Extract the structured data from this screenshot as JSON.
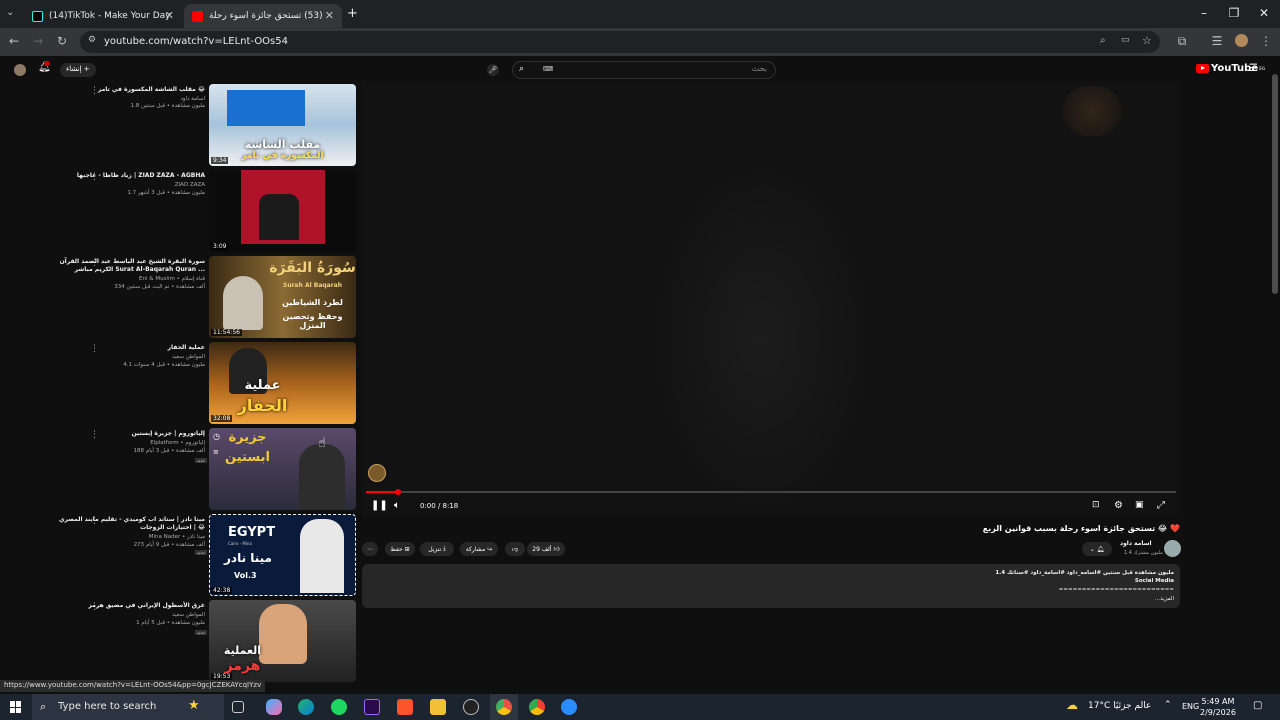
{
  "browser": {
    "tabs": [
      {
        "title": "(14)TikTok - Make Your Day",
        "active": false
      },
      {
        "title": "(53) تستحق جائزة اسوء رحلة",
        "active": true
      }
    ],
    "url": "youtube.com/watch?v=LELnt-OOs54",
    "status_url": "https://www.youtube.com/watch?v=LELnt-OOs54&pp=0gcJCZEKAYcqIYzv"
  },
  "yt_header": {
    "logo": "YouTube",
    "logo_region": "EG",
    "search_placeholder": "بحث",
    "create_label": "إنشاء"
  },
  "recommendations": [
    {
      "title": "مقلب الشاشة المكسورة في تامر 😂",
      "channel": "اسامة داود",
      "meta": "1.8 مليون مشاهدة • قبل سنتين",
      "duration": "9:34"
    },
    {
      "title": "زياد ظاظا - عاجبها | ZIAD ZAZA - AGBHA",
      "channel": "ZIAD ZAZA",
      "meta": "1.7 مليون مشاهدة • قبل 3 أشهر",
      "duration": "3:09"
    },
    {
      "title": "سورة البقرة الشيخ عبد الباسط عبد الصمد القرآن الكريم مباشر Surat Al-Baqarah Quran ...",
      "channel": "Eni & Muslim • قناة إسلام",
      "meta": "334 ألف مشاهدة • تم البث قبل سنتين",
      "duration": "11:54:56"
    },
    {
      "title": "عملية الحفار",
      "channel": "المواطن سعيد",
      "meta": "4.1 مليون مشاهدة • قبل 4 سنوات",
      "duration": "32:08"
    },
    {
      "title": "إلياتوروم | جزيرة إبستين",
      "channel": "Elplatform • إلياتوروم",
      "meta": "188 ألف مشاهدة • قبل 3 أيام",
      "duration": "",
      "badge": "جديد"
    },
    {
      "title": "مينا نادر | ستاند اب كوميدي - تقليم مايند المصري 😂 | اختيارات الزوجات",
      "channel": "Mina Nader • مينا نادر",
      "meta": "273 ألف مشاهدة • قبل 9 أيام",
      "duration": "42:38",
      "badge": "جديد"
    },
    {
      "title": "غرق الأسطول الإيراني في مضيق هرمز",
      "channel": "المواطن سعيد",
      "meta": "1 مليون مشاهدة • قبل 5 أيام",
      "duration": "19:53",
      "badge": "جديد"
    }
  ],
  "thumb_texts": [
    "مقلب الشاشة",
    "المكسورة في تامر",
    "سُورَةُ البَقَرَة",
    "Surah Al Baqarah",
    "لطرد الشياطين",
    "وحفظ وتحصين المنزل",
    "عملية",
    "الحفار",
    "جزيرة",
    "ابستين",
    "EGYPT",
    "Cairo - Mina",
    "مينا نادر",
    "Vol.3",
    "العملية",
    "هرمز"
  ],
  "player": {
    "time": "0:00 / 8:18",
    "progress": 0.04
  },
  "video": {
    "title": "تستحق جائزة اسوء رحلة بسبب قوانين الربع 😂 ❤️",
    "channel": "اسامة داود",
    "subscribers": "1.4 مليون مشترك",
    "likes": "29 ألف",
    "share_label": "مشاركة",
    "download_label": "تنزيل",
    "save_label": "حفظ"
  },
  "description": {
    "line1": "1.4 مليون مشاهدة  قبل سنتين  #اسامه_داود #اسامة_داود #سناتك",
    "line2": "Social Media",
    "line3": "=========================",
    "line4": "...المزيد"
  },
  "taskbar": {
    "search_placeholder": "Type here to search",
    "weather": "17°C  عالم جزئيًا",
    "language": "ENG",
    "time": "5:49 AM",
    "date": "2/9/2026"
  },
  "colors": {
    "accent": "#ff0000",
    "bg": "#0f0f0f"
  }
}
